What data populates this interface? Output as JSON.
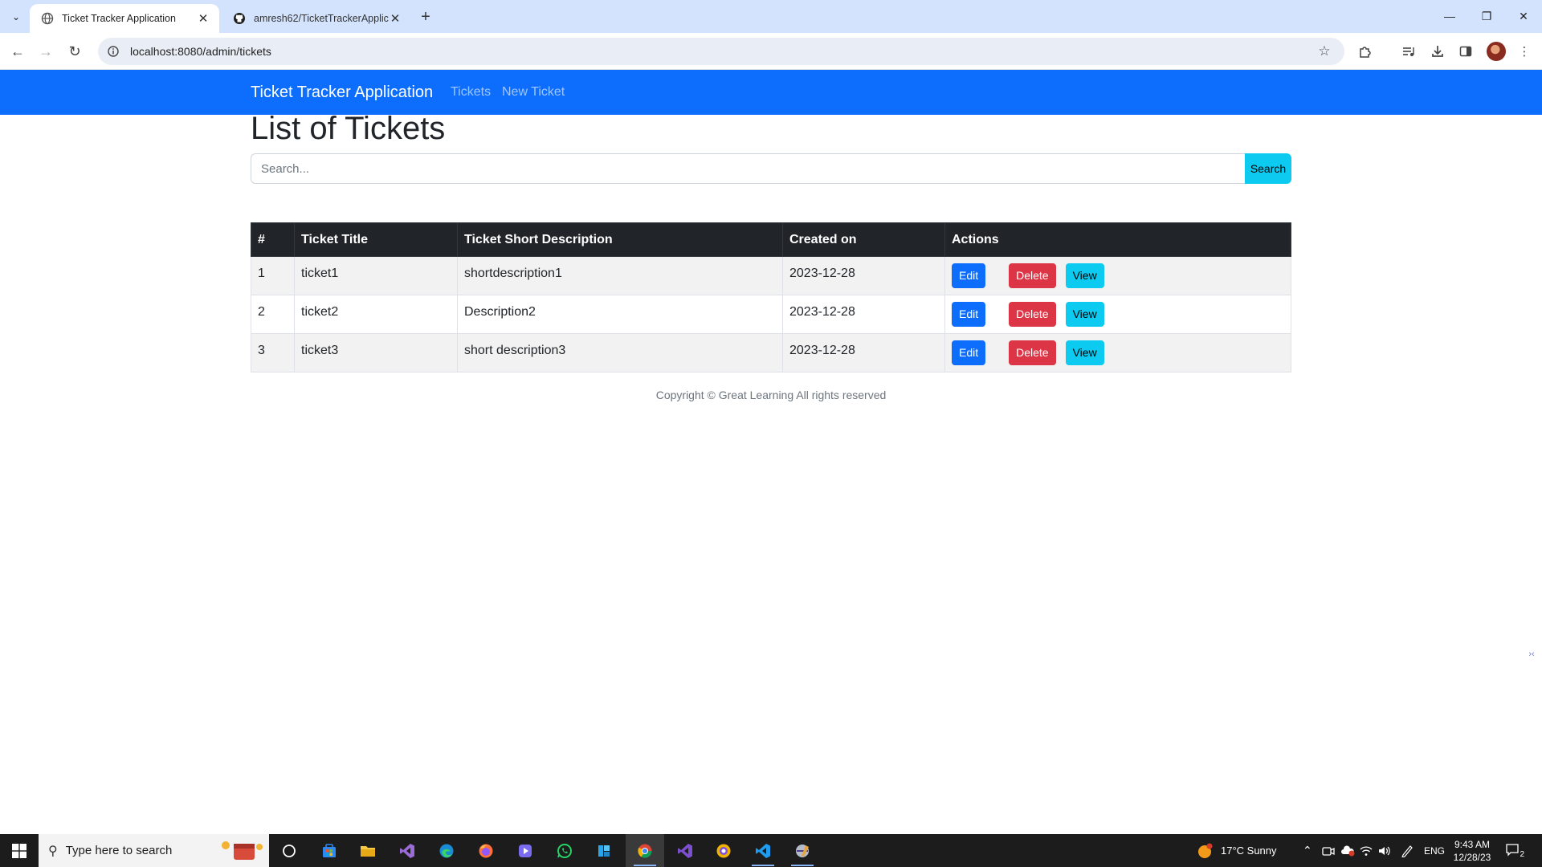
{
  "browser": {
    "tabs": [
      {
        "title": "Ticket Tracker Application",
        "active": true
      },
      {
        "title": "amresh62/TicketTrackerApplica",
        "active": false
      }
    ],
    "url": "localhost:8080/admin/tickets"
  },
  "app": {
    "brand": "Ticket Tracker Application",
    "nav": [
      {
        "label": "Tickets"
      },
      {
        "label": "New Ticket"
      }
    ],
    "accent_color": "#0d6efd"
  },
  "main": {
    "title": "List of Tickets",
    "search": {
      "placeholder": "Search...",
      "value": "",
      "button_label": "Search"
    },
    "table": {
      "headers": [
        "#",
        "Ticket Title",
        "Ticket Short Description",
        "Created on",
        "Actions"
      ],
      "rows": [
        {
          "num": "1",
          "title": "ticket1",
          "description": "shortdescription1",
          "created": "2023-12-28"
        },
        {
          "num": "2",
          "title": "ticket2",
          "description": "Description2",
          "created": "2023-12-28"
        },
        {
          "num": "3",
          "title": "ticket3",
          "description": "short description3",
          "created": "2023-12-28"
        }
      ],
      "actions": {
        "edit": "Edit",
        "delete": "Delete",
        "view": "View"
      }
    },
    "footer": "Copyright © Great Learning All rights reserved"
  },
  "taskbar": {
    "search_placeholder": "Type here to search",
    "weather": "17°C  Sunny",
    "language": "ENG",
    "time": "9:43 AM",
    "date": "12/28/23",
    "notification_count": "2"
  }
}
